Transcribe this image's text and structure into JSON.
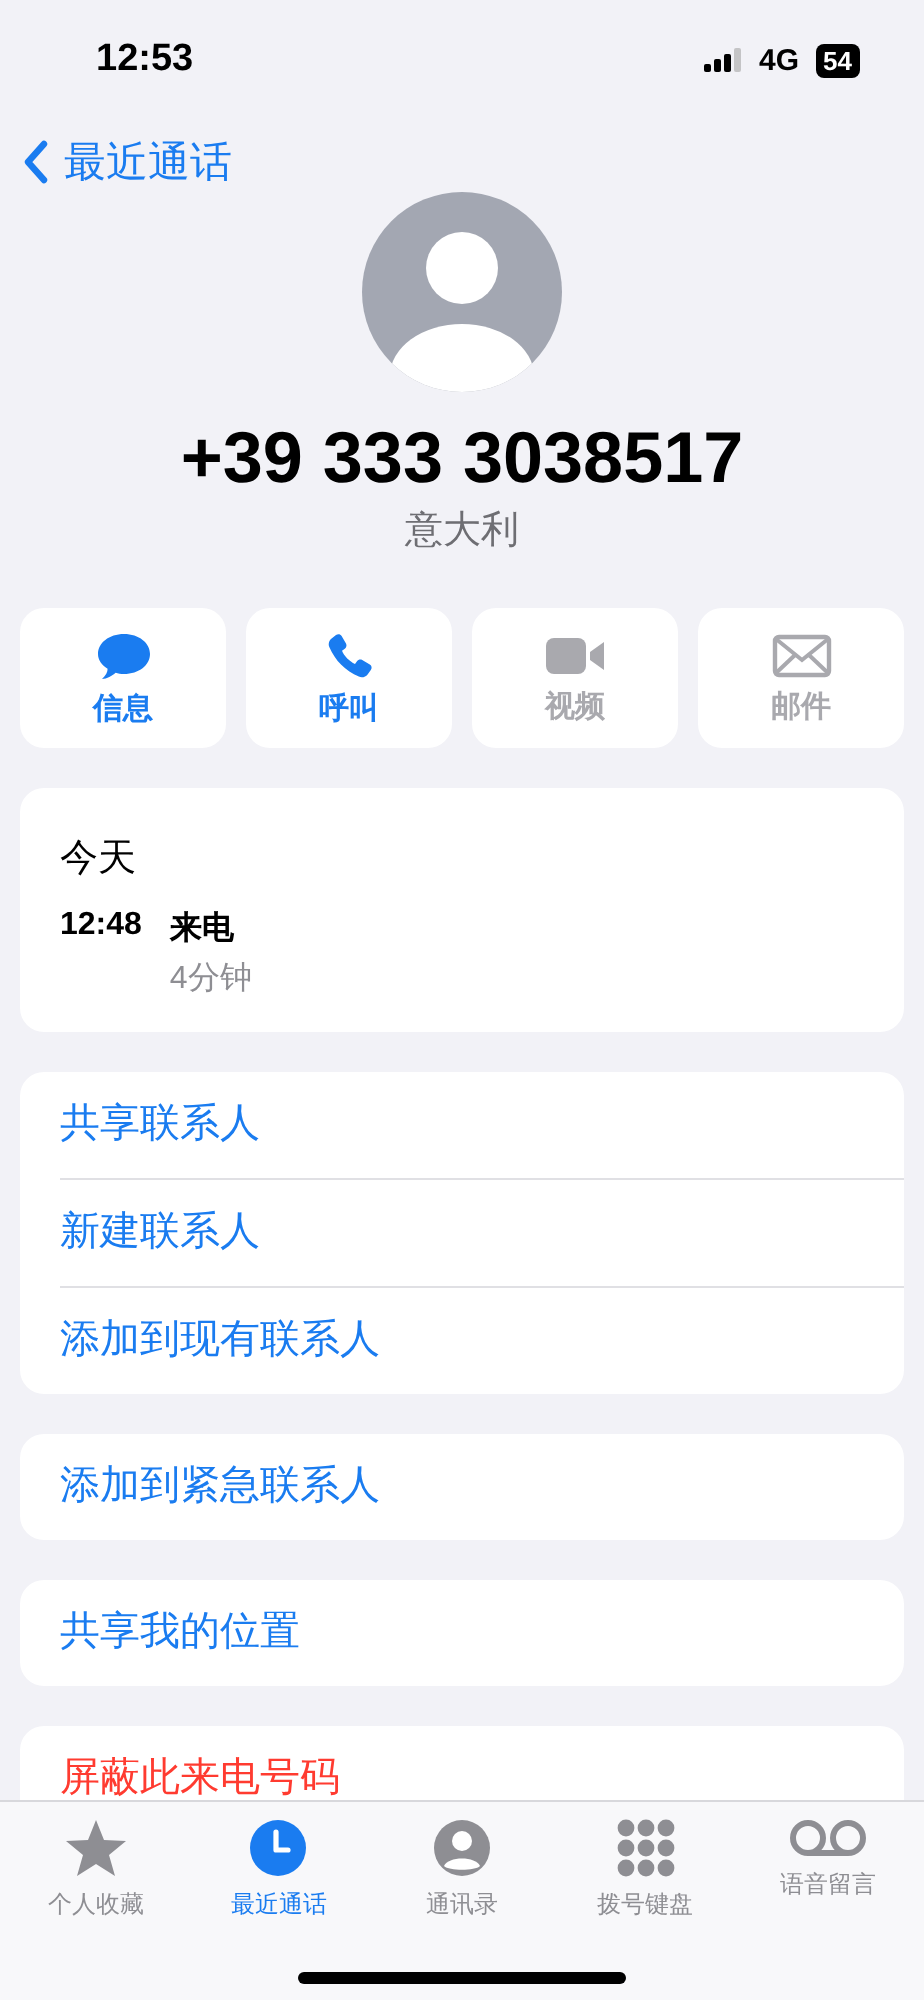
{
  "status_bar": {
    "time": "12:53",
    "network": "4G",
    "battery": "54"
  },
  "nav": {
    "back_label": "最近通话"
  },
  "contact": {
    "number": "+39 333 3038517",
    "country": "意大利"
  },
  "actions": [
    {
      "label": "信息",
      "kind": "message",
      "disabled": false
    },
    {
      "label": "呼叫",
      "kind": "call",
      "disabled": false
    },
    {
      "label": "视频",
      "kind": "video",
      "disabled": true
    },
    {
      "label": "邮件",
      "kind": "mail",
      "disabled": true
    }
  ],
  "call_history": {
    "date": "今天",
    "calls": [
      {
        "time": "12:48",
        "type": "来电",
        "duration": "4分钟"
      }
    ]
  },
  "option_groups": [
    {
      "items": [
        {
          "label": "共享联系人",
          "destructive": false
        },
        {
          "label": "新建联系人",
          "destructive": false
        },
        {
          "label": "添加到现有联系人",
          "destructive": false
        }
      ]
    },
    {
      "items": [
        {
          "label": "添加到紧急联系人",
          "destructive": false
        }
      ]
    },
    {
      "items": [
        {
          "label": "共享我的位置",
          "destructive": false
        }
      ]
    },
    {
      "items": [
        {
          "label": "屏蔽此来电号码",
          "destructive": true
        }
      ]
    }
  ],
  "tab_bar": [
    {
      "label": "个人收藏",
      "kind": "favorites",
      "selected": false
    },
    {
      "label": "最近通话",
      "kind": "recents",
      "selected": true
    },
    {
      "label": "通讯录",
      "kind": "contacts",
      "selected": false
    },
    {
      "label": "拨号键盘",
      "kind": "keypad",
      "selected": false
    },
    {
      "label": "语音留言",
      "kind": "voicemail",
      "selected": false
    }
  ]
}
